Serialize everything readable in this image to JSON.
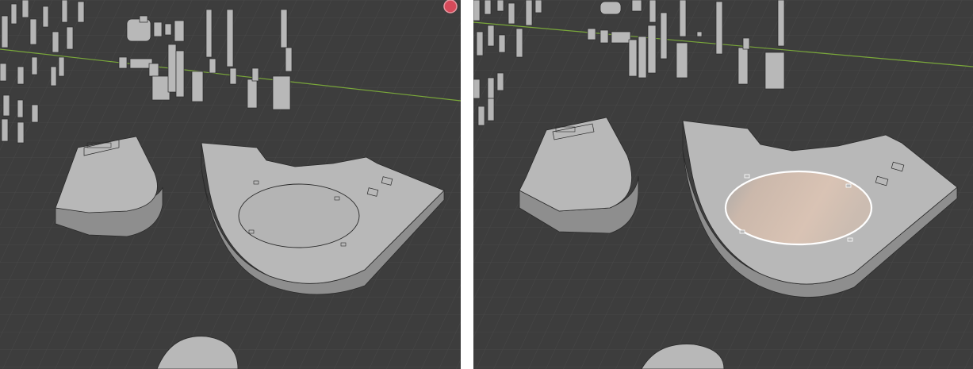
{
  "scene": {
    "background_color": "#3d3d3d",
    "grid_color": "#4a4a4a",
    "x_axis_color": "#7aa83a",
    "mesh_top_color": "#b8b8b8",
    "mesh_side_color": "#8e8e8e",
    "mesh_edge_color": "#2a2a2a",
    "selection_color": "#ffffff",
    "face_highlight_color": "#d9c3b4",
    "gizmo_color": "#d64a5a"
  },
  "viewports": [
    {
      "id": "viewport-before",
      "oval_state": "edge-outline",
      "gizmo_icon": "x-axis-gizmo-icon"
    },
    {
      "id": "viewport-after",
      "oval_state": "face-selected",
      "gizmo_icon": null
    }
  ]
}
